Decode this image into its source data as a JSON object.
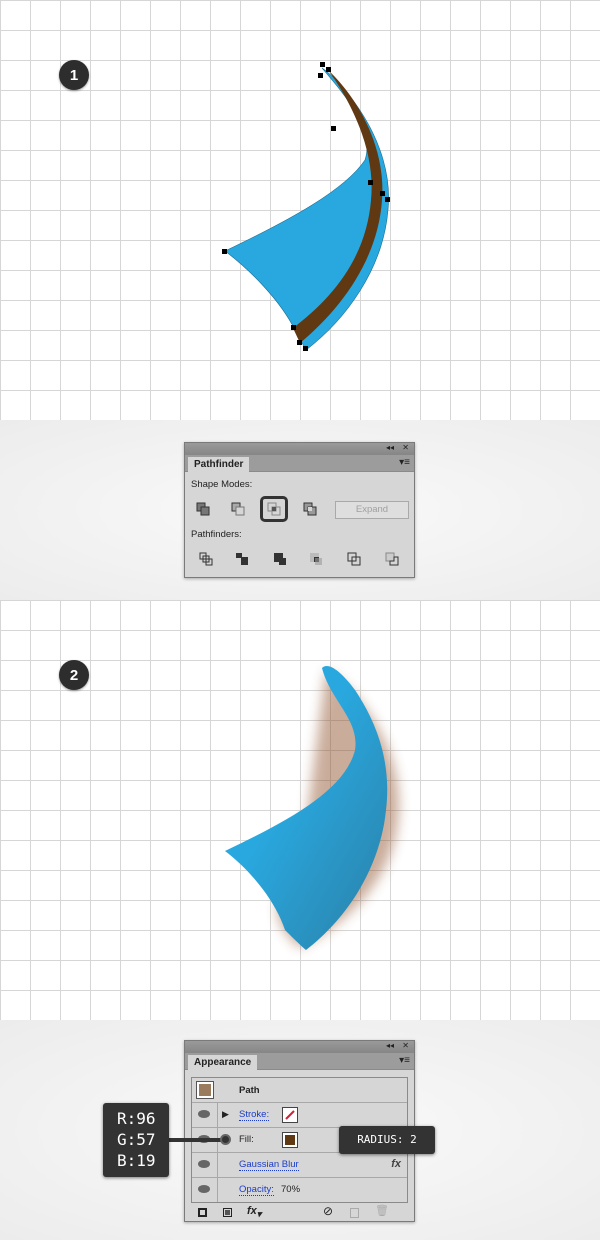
{
  "steps": [
    "1",
    "2"
  ],
  "colors": {
    "blue": "#29a8df",
    "brown": "#603913",
    "grid": "#d6d6d6"
  },
  "pathfinder": {
    "tab": "Pathfinder",
    "shape_modes_label": "Shape Modes:",
    "shape_modes": [
      "unite-icon",
      "minus-front-icon",
      "intersect-icon",
      "exclude-icon"
    ],
    "selected_shape_mode": "intersect-icon",
    "expand_label": "Expand",
    "pathfinders_label": "Pathfinders:",
    "pathfinders": [
      "divide-icon",
      "trim-icon",
      "merge-icon",
      "crop-icon",
      "outline-icon",
      "minus-back-icon"
    ]
  },
  "appearance": {
    "tab": "Appearance",
    "object": "Path",
    "stroke_label": "Stroke:",
    "fill_label": "Fill:",
    "effect_label": "Gaussian Blur",
    "opacity_label": "Opacity:",
    "opacity_value": "70%",
    "fill_color": "#603913",
    "fx": "fx"
  },
  "callouts": {
    "rgb": [
      "R:96",
      "G:57",
      "B:19"
    ],
    "radius": "RADIUS: 2"
  }
}
